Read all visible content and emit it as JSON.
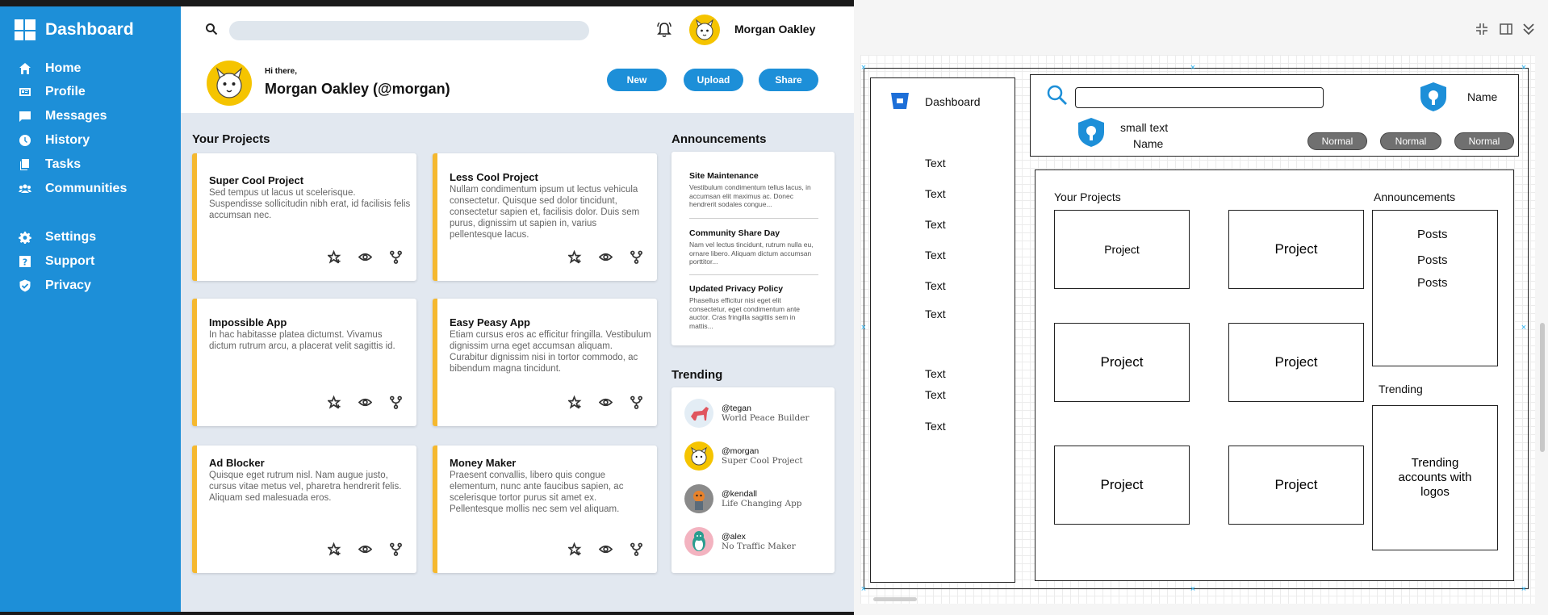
{
  "app": {
    "brand": "Dashboard",
    "nav_main": [
      "Home",
      "Profile",
      "Messages",
      "History",
      "Tasks",
      "Communities"
    ],
    "nav_secondary": [
      "Settings",
      "Support",
      "Privacy"
    ],
    "nav_icons": [
      "home-icon",
      "profile-card-icon",
      "message-icon",
      "clock-icon",
      "documents-icon",
      "group-icon",
      "gear-icon",
      "question-icon",
      "shield-check-icon"
    ],
    "accent_color": "#1d8fd8",
    "card_accent_color": "#f5b82e",
    "header": {
      "user_name": "Morgan Oakley",
      "greeting_small": "Hi there,",
      "greeting_big": "Morgan Oakley (@morgan)",
      "buttons": [
        "New",
        "Upload",
        "Share"
      ]
    },
    "projects_title": "Your Projects",
    "projects": [
      {
        "title": "Super Cool Project",
        "desc": "Sed tempus ut lacus ut scelerisque. Suspendisse sollicitudin nibh erat, id facilisis felis accumsan nec."
      },
      {
        "title": "Less Cool Project",
        "desc": "Nullam condimentum ipsum ut lectus vehicula consectetur. Quisque sed dolor tincidunt, consectetur sapien et, facilisis dolor. Duis sem purus, dignissim ut sapien in, varius pellentesque lacus."
      },
      {
        "title": "Impossible App",
        "desc": "In hac habitasse platea dictumst. Vivamus dictum rutrum arcu, a placerat velit sagittis id."
      },
      {
        "title": "Easy Peasy App",
        "desc": "Etiam cursus eros ac efficitur fringilla. Vestibulum dignissim urna eget accumsan aliquam. Curabitur dignissim nisi in tortor commodo, ac bibendum magna tincidunt."
      },
      {
        "title": "Ad Blocker",
        "desc": "Quisque eget rutrum nisl. Nam augue justo, cursus vitae metus vel, pharetra hendrerit felis. Aliquam sed malesuada eros."
      },
      {
        "title": "Money Maker",
        "desc": "Praesent convallis, libero quis congue elementum, nunc ante faucibus sapien, ac scelerisque tortor purus sit amet ex. Pellentesque mollis nec sem vel aliquam."
      }
    ],
    "announcements_title": "Announcements",
    "announcements": [
      {
        "title": "Site Maintenance",
        "body": "Vestibulum condimentum tellus lacus, in accumsan elit maximus ac. Donec hendrerit sodales congue..."
      },
      {
        "title": "Community Share Day",
        "body": "Nam vel lectus tincidunt, rutrum nulla eu, ornare libero. Aliquam dictum accumsan porttitor..."
      },
      {
        "title": "Updated Privacy Policy",
        "body": "Phasellus efficitur nisi eget elit consectetur, eget condimentum ante auctor. Cras fringilla sagittis sem in mattis..."
      }
    ],
    "trending_title": "Trending",
    "trending": [
      {
        "handle": "@tegan",
        "sub": "World Peace Builder"
      },
      {
        "handle": "@morgan",
        "sub": "Super Cool Project"
      },
      {
        "handle": "@kendall",
        "sub": "Life Changing App"
      },
      {
        "handle": "@alex",
        "sub": "No Traffic Maker"
      }
    ]
  },
  "wireframe": {
    "sidebar_title": "Dashboard",
    "sidebar_items": [
      "Text",
      "Text",
      "Text",
      "Text",
      "Text",
      "Text",
      "Text",
      "Text",
      "Text"
    ],
    "header_name_right": "Name",
    "small_text": "small text",
    "header_name": "Name",
    "pills": [
      "Normal",
      "Normal",
      "Normal"
    ],
    "projects_title": "Your Projects",
    "project_label": "Project",
    "announcements_title": "Announcements",
    "posts": [
      "Posts",
      "Posts",
      "Posts"
    ],
    "trending_title": "Trending",
    "trending_body": "Trending accounts with logos"
  }
}
